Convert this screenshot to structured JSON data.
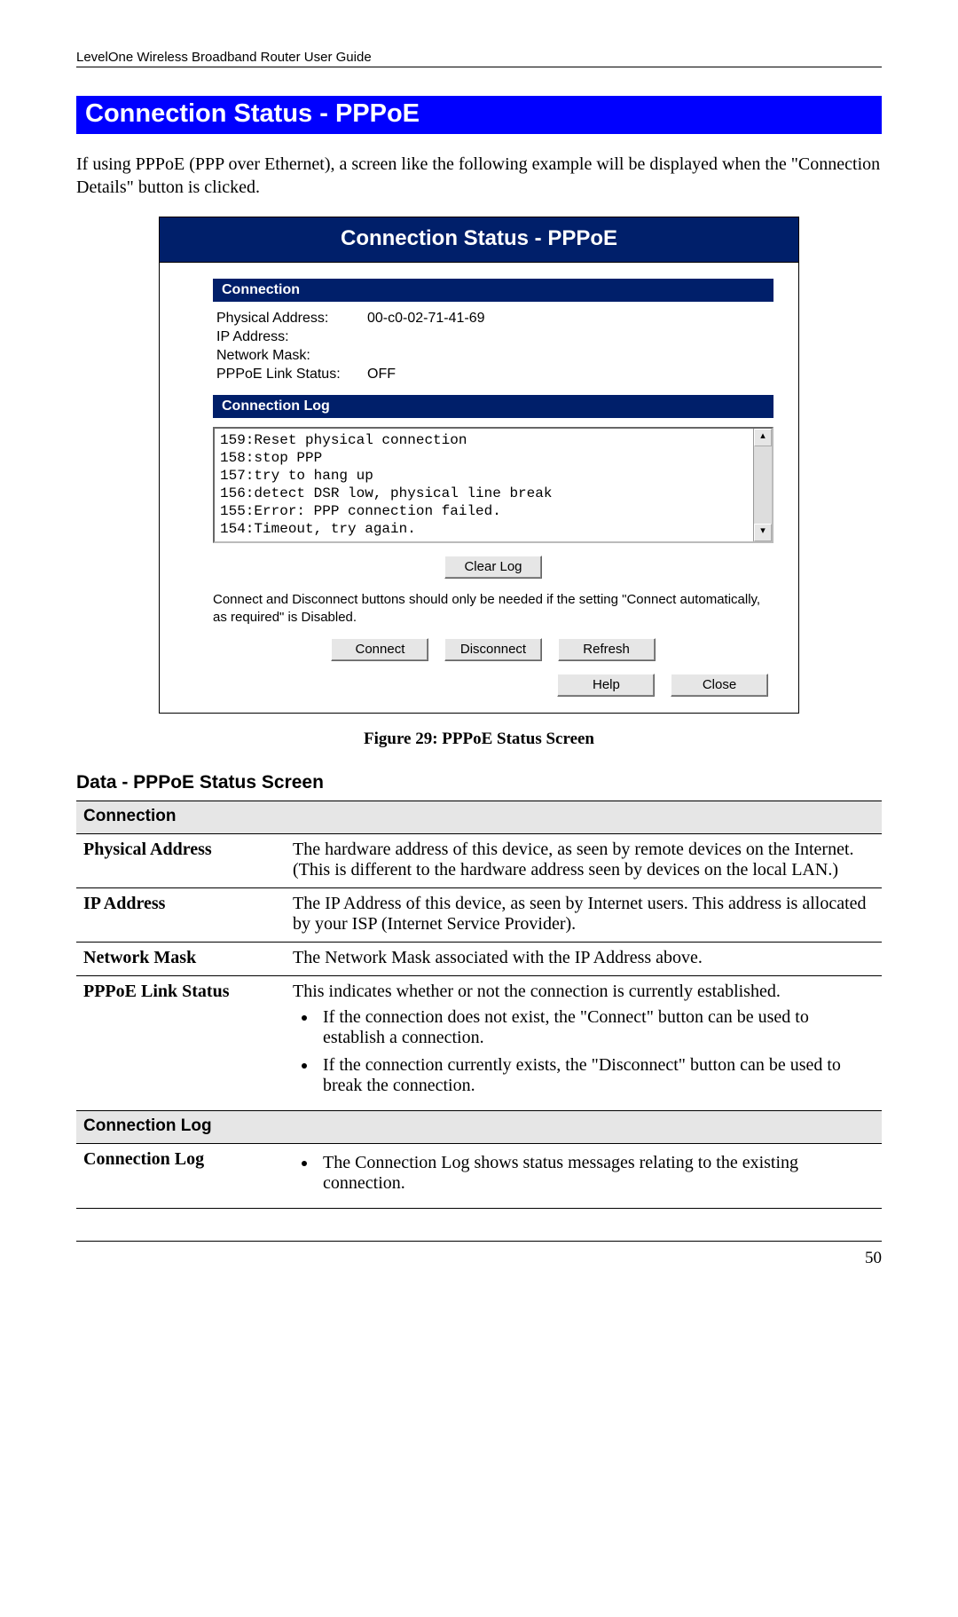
{
  "header": "LevelOne Wireless Broadband Router User Guide",
  "section_title": "Connection Status - PPPoE",
  "intro": "If using PPPoE (PPP over Ethernet), a screen like the following example will be displayed when the \"Connection Details\" button is clicked.",
  "panel": {
    "title": "Connection Status - PPPoE",
    "connection_header": "Connection",
    "rows": {
      "physical_label": "Physical Address:",
      "physical_value": "00-c0-02-71-41-69",
      "ip_label": "IP Address:",
      "ip_value": "",
      "mask_label": "Network Mask:",
      "mask_value": "",
      "link_label": "PPPoE Link Status:",
      "link_value": "OFF"
    },
    "log_header": "Connection Log",
    "log_lines": "159:Reset physical connection\n158:stop PPP\n157:try to hang up\n156:detect DSR low, physical line break\n155:Error: PPP connection failed.\n154:Timeout, try again.",
    "clear_log": "Clear Log",
    "note": "Connect and Disconnect buttons should only be needed if the setting \"Connect automatically, as required\" is Disabled.",
    "buttons": {
      "connect": "Connect",
      "disconnect": "Disconnect",
      "refresh": "Refresh",
      "help": "Help",
      "close": "Close"
    }
  },
  "figure_caption": "Figure 29: PPPoE Status Screen",
  "data_title": "Data - PPPoE Status Screen",
  "table": {
    "section_connection": "Connection",
    "physical": {
      "label": "Physical Address",
      "desc": "The hardware address of this device, as seen by remote devices on the Internet. (This is different to the hardware address seen by devices on the local LAN.)"
    },
    "ip": {
      "label": "IP Address",
      "desc": "The IP Address of this device, as seen by Internet users. This address is allocated by your ISP (Internet Service Provider)."
    },
    "mask": {
      "label": "Network Mask",
      "desc": "The Network Mask associated with the IP Address above."
    },
    "link": {
      "label": "PPPoE Link Status",
      "desc": "This indicates whether or not the connection is currently established.",
      "b1": "If the connection does not exist, the \"Connect\" button can be used to establish a connection.",
      "b2": "If the connection currently exists, the \"Disconnect\" button can be used to break the connection."
    },
    "section_log": "Connection Log",
    "log": {
      "label": "Connection Log",
      "b1": "The Connection Log shows status messages relating to the existing connection."
    }
  },
  "page_number": "50"
}
